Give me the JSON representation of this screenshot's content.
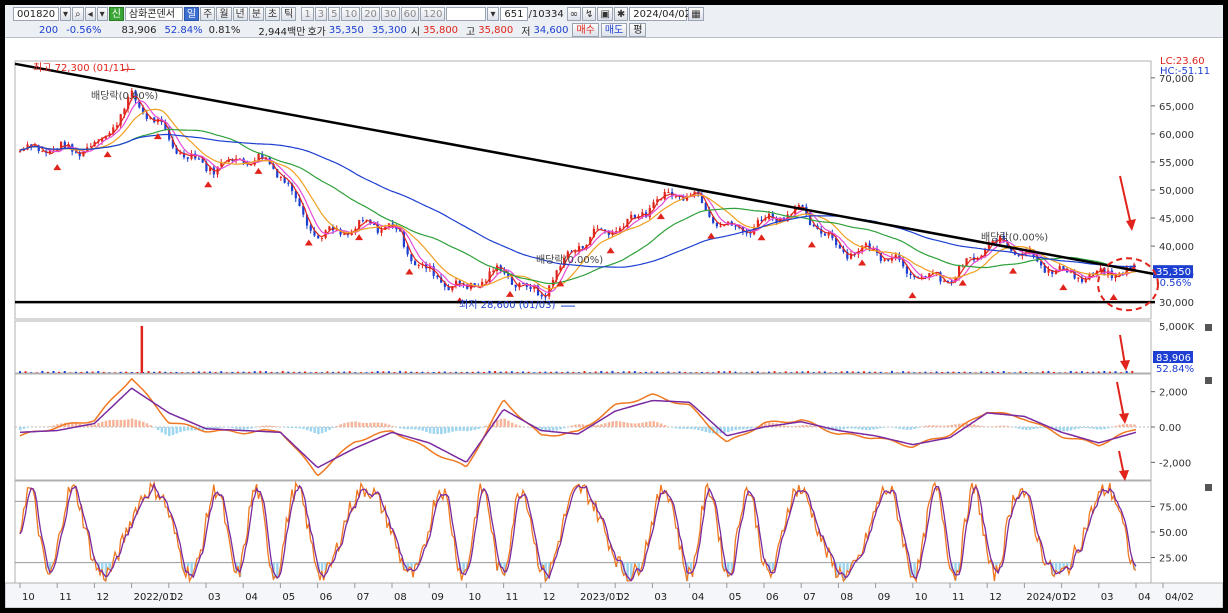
{
  "toolbar": {
    "code": "001820",
    "mode": "신",
    "name": "삼화콘덴서",
    "periods": [
      "일",
      "주",
      "월",
      "년",
      "분",
      "초",
      "틱"
    ],
    "active_period": "일",
    "numbers": [
      "1",
      "3",
      "5",
      "10",
      "20",
      "30",
      "60",
      "120"
    ],
    "count": "651",
    "total": "/10334",
    "date": "2024/04/02"
  },
  "quote": {
    "change": "200",
    "change_pct": "-0.56%",
    "volume": "83,906",
    "vol_ratio": "52.84%",
    "turnover": "0.81%",
    "amount": "2,944백만",
    "hoga_label": "호가",
    "ask": "35,350",
    "bid": "35,300",
    "open_label": "시",
    "open": "35,800",
    "high_label": "고",
    "high": "35,800",
    "low_label": "저",
    "low": "34,600",
    "buy_label": "매수",
    "sell_label": "매도",
    "avg_label": "평"
  },
  "colors": {
    "up": "#e0241b",
    "down": "#1c3fd1",
    "ma5": "#e0241b",
    "ma10": "#e54bd6",
    "ma20": "#f0a020",
    "ma60": "#2ea03a",
    "ma120": "#1c3fd1",
    "macd_line": "#f07820",
    "macd_signal": "#7a2aa0",
    "hist_pos": "#f6b49a",
    "hist_neg": "#9ed6f0",
    "trend": "#000000",
    "arrow": "#e0241b"
  },
  "chart_data": [
    {
      "type": "line",
      "panel": "price",
      "title": "",
      "ylim": [
        27000,
        73000
      ],
      "y_ticks": [
        "70,000",
        "65,000",
        "60,000",
        "55,000",
        "50,000",
        "45,000",
        "40,000",
        "35,000",
        "30,000"
      ],
      "x_tick_labels": [
        "10",
        "11",
        "12",
        "2022/01",
        "02",
        "03",
        "04",
        "05",
        "06",
        "07",
        "08",
        "09",
        "10",
        "11",
        "12",
        "2023/01",
        "02",
        "03",
        "04",
        "05",
        "06",
        "07",
        "08",
        "09",
        "10",
        "11",
        "12",
        "2024/01",
        "02",
        "03",
        "04",
        "04/02"
      ],
      "close_points": [
        {
          "date": "2021/10",
          "close": 57000
        },
        {
          "date": "2021/11",
          "close": 56000
        },
        {
          "date": "2021/12",
          "close": 59000
        },
        {
          "date": "2022/01",
          "close": 66000
        },
        {
          "date": "2022/02",
          "close": 58000
        },
        {
          "date": "2022/03",
          "close": 55500
        },
        {
          "date": "2022/04",
          "close": 55000
        },
        {
          "date": "2022/05",
          "close": 53000
        },
        {
          "date": "2022/06",
          "close": 43000
        },
        {
          "date": "2022/07",
          "close": 42000
        },
        {
          "date": "2022/08",
          "close": 43500
        },
        {
          "date": "2022/09",
          "close": 36000
        },
        {
          "date": "2022/10",
          "close": 31000
        },
        {
          "date": "2022/11",
          "close": 36000
        },
        {
          "date": "2022/12",
          "close": 32000
        },
        {
          "date": "2023/01",
          "close": 39000
        },
        {
          "date": "2023/02",
          "close": 44000
        },
        {
          "date": "2023/03",
          "close": 48000
        },
        {
          "date": "2023/04",
          "close": 48500
        },
        {
          "date": "2023/05",
          "close": 44000
        },
        {
          "date": "2023/06",
          "close": 44500
        },
        {
          "date": "2023/07",
          "close": 45000
        },
        {
          "date": "2023/08",
          "close": 41000
        },
        {
          "date": "2023/09",
          "close": 39000
        },
        {
          "date": "2023/10",
          "close": 34000
        },
        {
          "date": "2023/11",
          "close": 35500
        },
        {
          "date": "2023/12",
          "close": 39500
        },
        {
          "date": "2024/01",
          "close": 38500
        },
        {
          "date": "2024/02",
          "close": 36500
        },
        {
          "date": "2024/03",
          "close": 33500
        },
        {
          "date": "2024/04",
          "close": 35350
        }
      ],
      "annotations": {
        "high": "최고 72,300 (01/11)",
        "low": "최저 28,600 (01/03)",
        "dividend": "배당락(0.00%)",
        "dividend2": "배당락(0.00%)",
        "dividend3": "배당락(0.00%)",
        "last_price": "35,350",
        "last_change": "-0.56%",
        "lc": "LC:23.60",
        "hc": "HC:-51.11"
      },
      "trendline": {
        "start": 72500,
        "end": 35000,
        "support": 30000
      }
    },
    {
      "type": "bar",
      "panel": "volume",
      "y_ticks": [
        "5,000K"
      ],
      "last_volume": "83,906",
      "last_ratio": "52.84%",
      "spike_date": "2022/01",
      "spike_value": 4900
    },
    {
      "type": "line",
      "panel": "macd",
      "y_ticks": [
        "2,000",
        "0.00",
        "-2,000"
      ],
      "ylim": [
        -3000,
        3000
      ],
      "points": [
        {
          "date": "2021/10",
          "macd": -500,
          "signal": -300
        },
        {
          "date": "2021/11",
          "macd": 0,
          "signal": -200
        },
        {
          "date": "2021/12",
          "macd": 400,
          "signal": 200
        },
        {
          "date": "2022/01",
          "macd": 2800,
          "signal": 2200
        },
        {
          "date": "2022/02",
          "macd": 300,
          "signal": 800
        },
        {
          "date": "2022/03",
          "macd": -200,
          "signal": -100
        },
        {
          "date": "2022/04",
          "macd": -300,
          "signal": -200
        },
        {
          "date": "2022/05",
          "macd": -200,
          "signal": -300
        },
        {
          "date": "2022/06",
          "macd": -2700,
          "signal": -2300
        },
        {
          "date": "2022/07",
          "macd": -800,
          "signal": -1200
        },
        {
          "date": "2022/08",
          "macd": -200,
          "signal": -300
        },
        {
          "date": "2022/09",
          "macd": -1300,
          "signal": -900
        },
        {
          "date": "2022/10",
          "macd": -2300,
          "signal": -2000
        },
        {
          "date": "2022/11",
          "macd": 1500,
          "signal": 1000
        },
        {
          "date": "2022/12",
          "macd": -500,
          "signal": -200
        },
        {
          "date": "2023/01",
          "macd": -300,
          "signal": -400
        },
        {
          "date": "2023/02",
          "macd": 1200,
          "signal": 900
        },
        {
          "date": "2023/03",
          "macd": 1800,
          "signal": 1500
        },
        {
          "date": "2023/04",
          "macd": 1200,
          "signal": 1400
        },
        {
          "date": "2023/05",
          "macd": -900,
          "signal": -500
        },
        {
          "date": "2023/06",
          "macd": 200,
          "signal": 0
        },
        {
          "date": "2023/07",
          "macd": 400,
          "signal": 300
        },
        {
          "date": "2023/08",
          "macd": -400,
          "signal": -200
        },
        {
          "date": "2023/09",
          "macd": -600,
          "signal": -500
        },
        {
          "date": "2023/10",
          "macd": -1100,
          "signal": -1000
        },
        {
          "date": "2023/11",
          "macd": -400,
          "signal": -600
        },
        {
          "date": "2023/12",
          "macd": 900,
          "signal": 800
        },
        {
          "date": "2024/01",
          "macd": 500,
          "signal": 600
        },
        {
          "date": "2024/02",
          "macd": -500,
          "signal": -300
        },
        {
          "date": "2024/03",
          "macd": -1000,
          "signal": -900
        },
        {
          "date": "2024/04",
          "macd": -100,
          "signal": -300
        }
      ]
    },
    {
      "type": "line",
      "panel": "stochastic",
      "y_ticks": [
        "75.00",
        "50.00",
        "25.00"
      ],
      "ylim": [
        0,
        100
      ],
      "bands": [
        80,
        20
      ]
    }
  ]
}
